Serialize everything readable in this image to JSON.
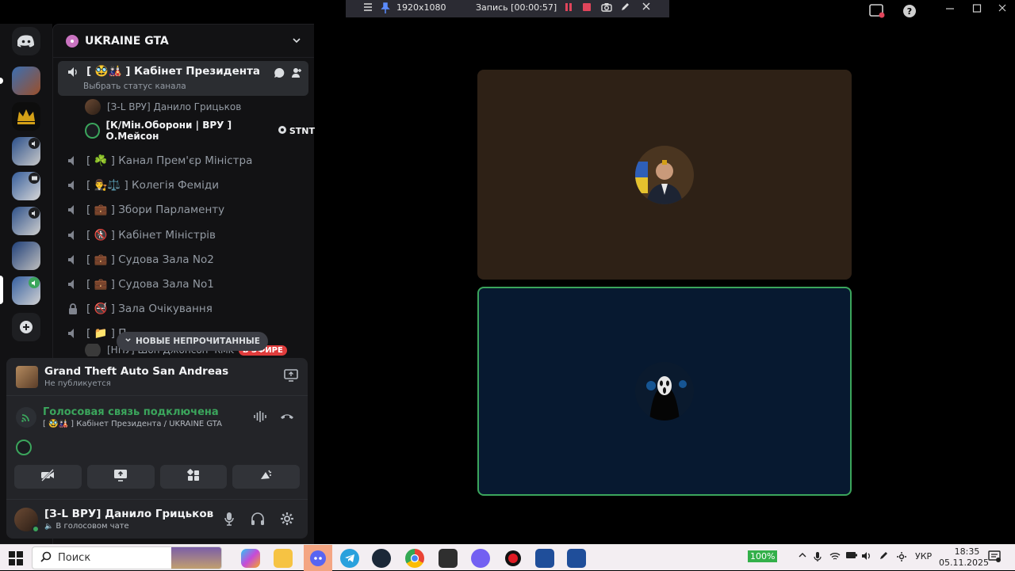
{
  "recorder": {
    "resolution": "1920x1080",
    "status": "Запись [00:00:57]"
  },
  "server": {
    "name": "UKRAINE GTA"
  },
  "channels": [
    {
      "label": "[ 🥸🎎 ] Кабінет Президента",
      "subtitle": "Выбрать статус канала",
      "active": true
    },
    {
      "label": "[ ☘️ ] Канал Прем'єр Міністра"
    },
    {
      "label": "[ 👨‍⚖️⚖️ ] Колегія Феміди"
    },
    {
      "label": "[ 💼 ] Збори Парламенту"
    },
    {
      "label": "[ 🚷 ] Кабінет Міністрів"
    },
    {
      "label": "[ 💼 ] Судова Зала No2"
    },
    {
      "label": "[ 💼 ] Судова Зала No1"
    },
    {
      "label": "[ 🚭 ] Зала Очікування"
    },
    {
      "label": "[ 📁 ] П..."
    }
  ],
  "members": [
    {
      "name": "[З-L ВРУ] Данило Грицьков"
    },
    {
      "name": "[К/Мін.Оборони | ВРУ ] О.Мейсон",
      "tag": "STNT"
    }
  ],
  "hidden_member": {
    "name": "[НПУ] Шон Джонсон",
    "tag": "RMK",
    "live": "В ЭФИРЕ"
  },
  "unread_label": "НОВЫЕ НЕПРОЧИТАННЫЕ",
  "activity": {
    "game": "Grand Theft Auto San Andreas",
    "status": "Не публикуется"
  },
  "voice": {
    "status": "Голосовая связь подключена",
    "location": "[ 🥸🎎 ] Кабінет Президента / UKRAINE GTA"
  },
  "user": {
    "name": "[З-L ВРУ] Данило Грицьков",
    "status": "В голосовом чате"
  },
  "taskbar": {
    "search_placeholder": "Поиск",
    "battery": "100%",
    "language": "УКР",
    "time": "18:35",
    "date": "05.11.2025"
  },
  "colors": {
    "connected_green": "#3ba55c",
    "tile1_bg": "#2e2116",
    "tile2_bg": "#071930"
  }
}
